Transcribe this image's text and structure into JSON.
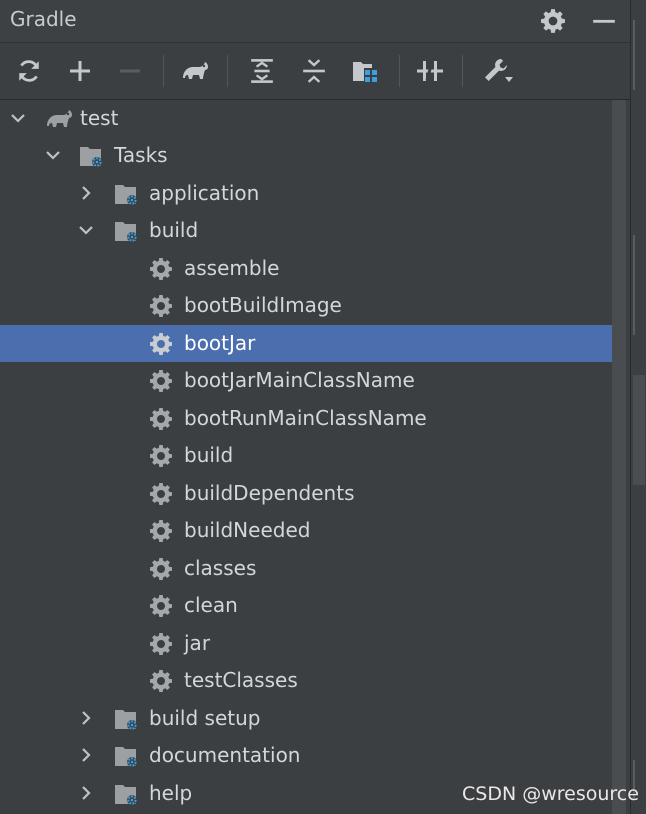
{
  "header": {
    "title": "Gradle"
  },
  "toolbar": {
    "buttons": [
      "refresh-icon",
      "add-icon",
      "remove-icon",
      "elephant-icon",
      "expand-all-icon",
      "collapse-all-icon",
      "group-modules-icon",
      "toggle-offline-icon",
      "wrench-icon"
    ]
  },
  "tree": {
    "root": "test",
    "tasks": "Tasks",
    "groups": {
      "application": "application",
      "build": "build",
      "build_setup": "build setup",
      "documentation": "documentation",
      "help": "help"
    },
    "build_tasks": [
      "assemble",
      "bootBuildImage",
      "bootJar",
      "bootJarMainClassName",
      "bootRunMainClassName",
      "build",
      "buildDependents",
      "buildNeeded",
      "classes",
      "clean",
      "jar",
      "testClasses"
    ],
    "selected": "bootJar"
  },
  "colors": {
    "selection": "#4b6eaf",
    "background": "#3c3f41",
    "folder_badge": "#3d9ee0"
  },
  "watermark": "CSDN @wresource"
}
